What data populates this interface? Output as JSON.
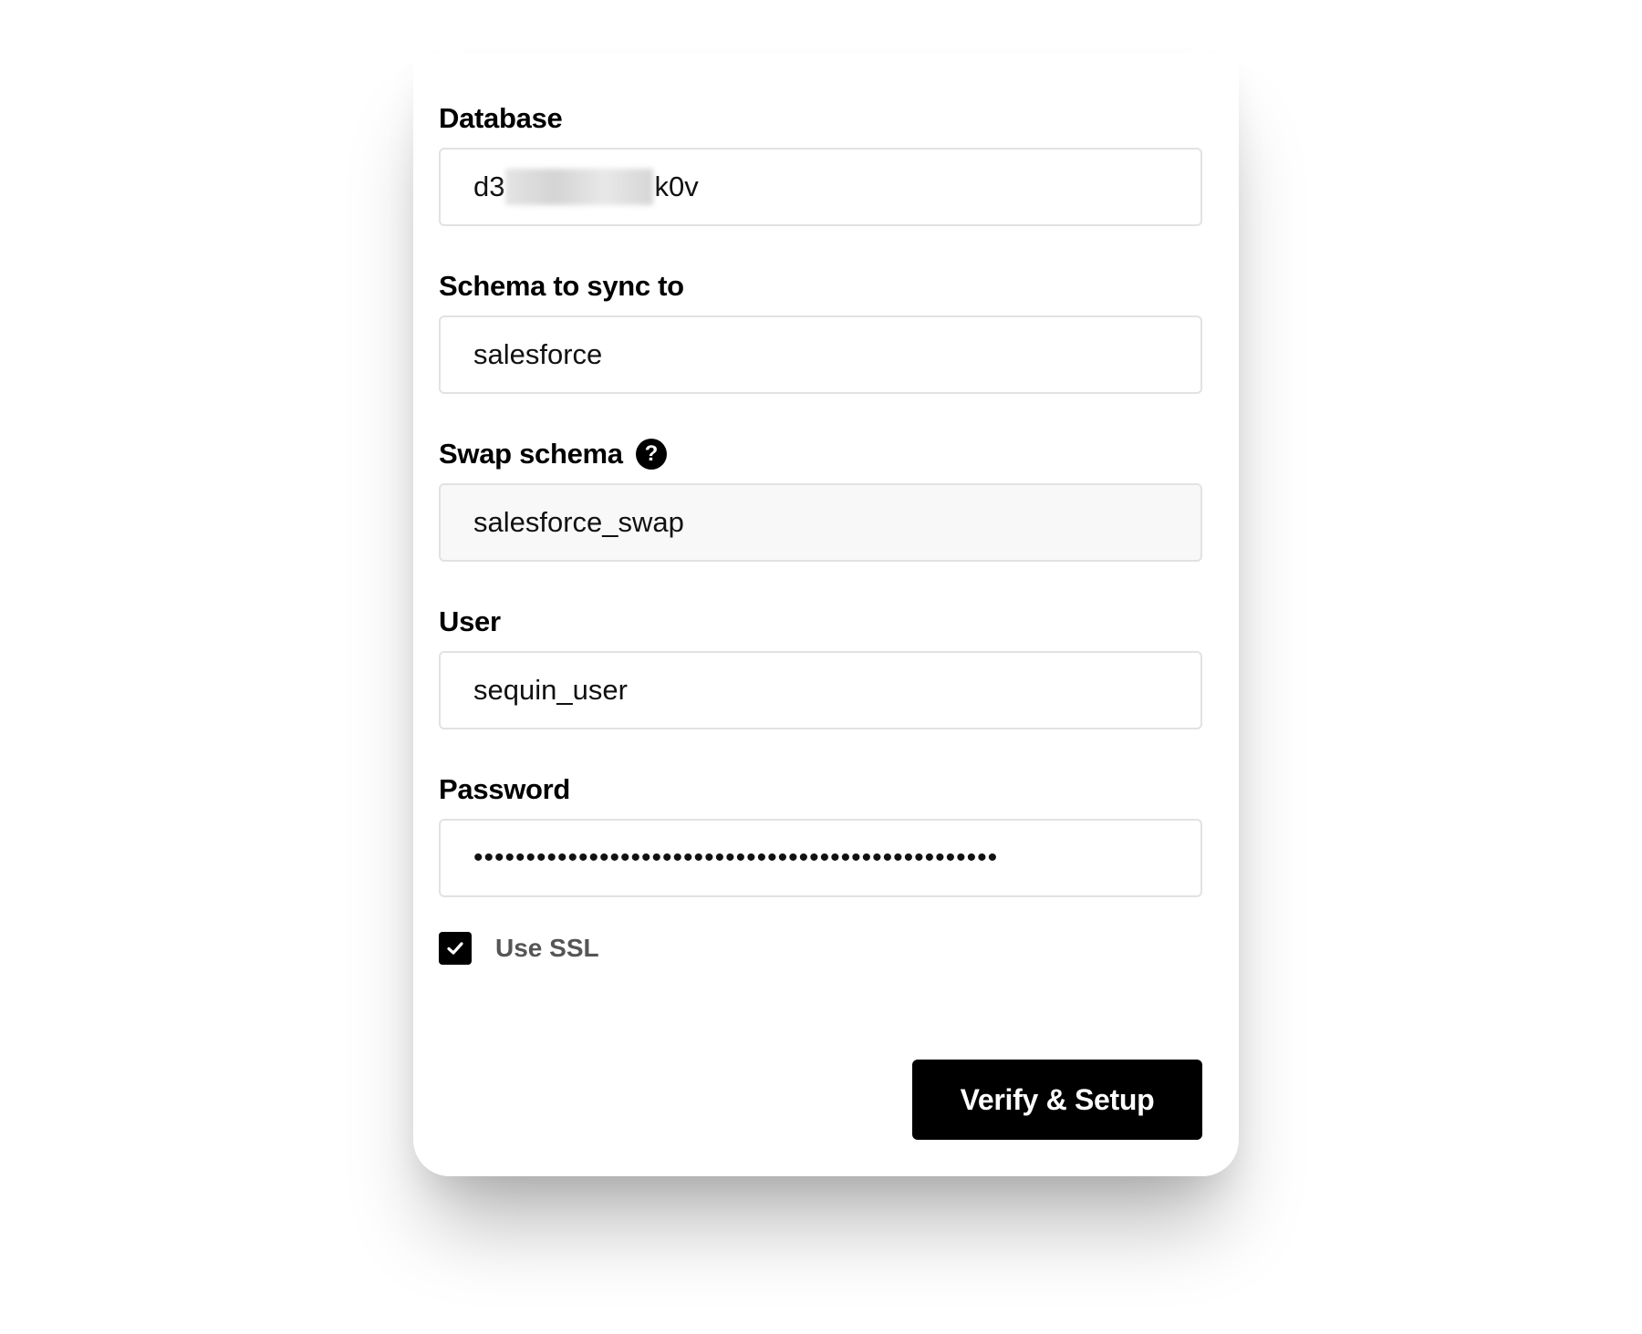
{
  "form": {
    "database": {
      "label": "Database",
      "value_prefix": "d3",
      "value_suffix": "k0v"
    },
    "schema": {
      "label": "Schema to sync to",
      "value": "salesforce"
    },
    "swap_schema": {
      "label": "Swap schema",
      "help_glyph": "?",
      "value": "salesforce_swap"
    },
    "user": {
      "label": "User",
      "value": "sequin_user"
    },
    "password": {
      "label": "Password",
      "masked_value": "••••••••••••••••••••••••••••••••••••••••••••••••••"
    },
    "ssl": {
      "label": "Use SSL",
      "checked": true
    },
    "submit_label": "Verify & Setup"
  },
  "icons": {
    "help": "question-circle-icon",
    "check": "checkmark-icon"
  },
  "colors": {
    "primary": "#000000",
    "border": "#e2e2e2",
    "disabled_bg": "#f8f8f8",
    "muted_text": "#555555"
  }
}
